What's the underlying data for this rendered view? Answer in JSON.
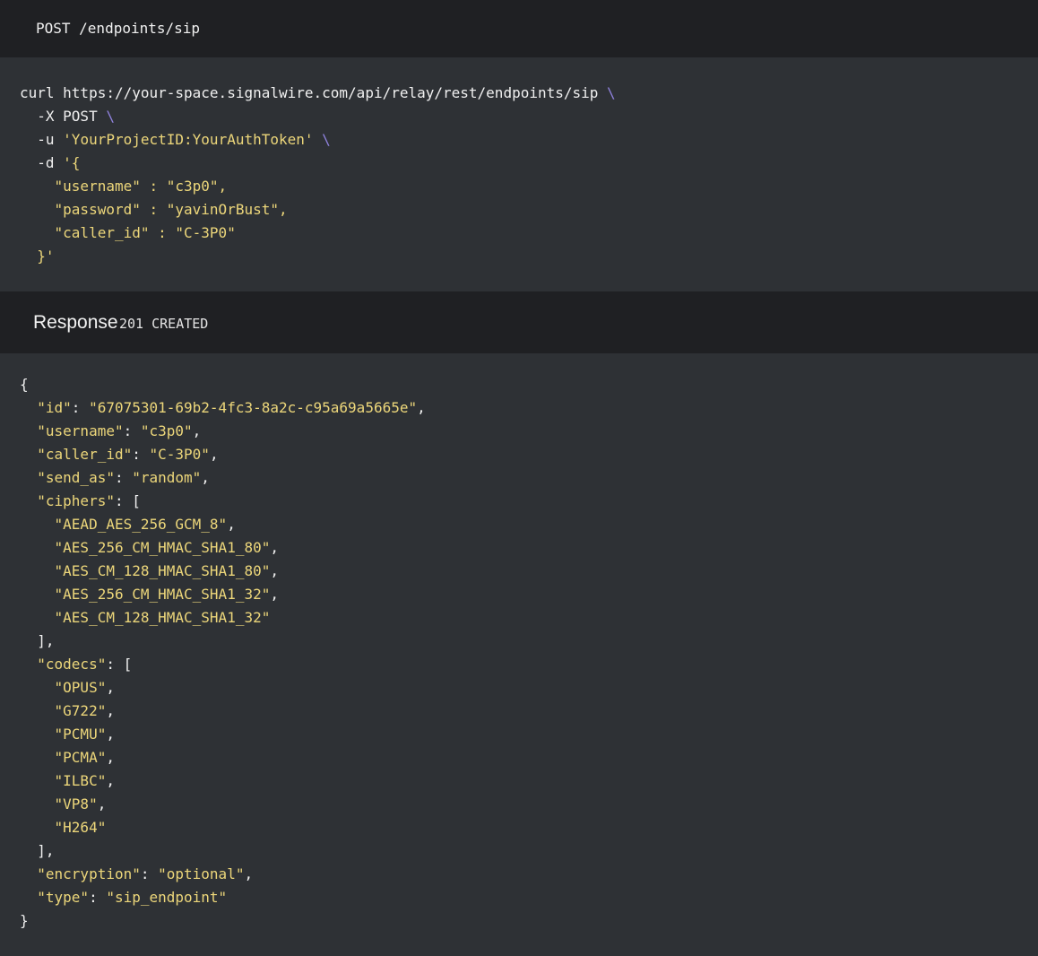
{
  "request": {
    "method_path": "POST /endpoints/sip",
    "lines": [
      [
        {
          "t": "plain",
          "v": "curl https://your-space.signalwire.com/api/relay/rest/endpoints/sip "
        },
        {
          "t": "cont",
          "v": "\\"
        }
      ],
      [
        {
          "t": "plain",
          "v": "  -X POST "
        },
        {
          "t": "cont",
          "v": "\\"
        }
      ],
      [
        {
          "t": "plain",
          "v": "  -u "
        },
        {
          "t": "str",
          "v": "'YourProjectID:YourAuthToken'"
        },
        {
          "t": "plain",
          "v": " "
        },
        {
          "t": "cont",
          "v": "\\"
        }
      ],
      [
        {
          "t": "plain",
          "v": "  -d "
        },
        {
          "t": "str",
          "v": "'{"
        }
      ],
      [
        {
          "t": "str",
          "v": "    \"username\" : \"c3p0\","
        }
      ],
      [
        {
          "t": "str",
          "v": "    \"password\" : \"yavinOrBust\","
        }
      ],
      [
        {
          "t": "str",
          "v": "    \"caller_id\" : \"C-3P0\""
        }
      ],
      [
        {
          "t": "str",
          "v": "  }'"
        }
      ]
    ]
  },
  "response": {
    "title": "Response",
    "status": "201 CREATED",
    "lines": [
      [
        {
          "t": "plain",
          "v": "{"
        }
      ],
      [
        {
          "t": "plain",
          "v": "  "
        },
        {
          "t": "str",
          "v": "\"id\""
        },
        {
          "t": "plain",
          "v": ": "
        },
        {
          "t": "str",
          "v": "\"67075301-69b2-4fc3-8a2c-c95a69a5665e\""
        },
        {
          "t": "plain",
          "v": ","
        }
      ],
      [
        {
          "t": "plain",
          "v": "  "
        },
        {
          "t": "str",
          "v": "\"username\""
        },
        {
          "t": "plain",
          "v": ": "
        },
        {
          "t": "str",
          "v": "\"c3p0\""
        },
        {
          "t": "plain",
          "v": ","
        }
      ],
      [
        {
          "t": "plain",
          "v": "  "
        },
        {
          "t": "str",
          "v": "\"caller_id\""
        },
        {
          "t": "plain",
          "v": ": "
        },
        {
          "t": "str",
          "v": "\"C-3P0\""
        },
        {
          "t": "plain",
          "v": ","
        }
      ],
      [
        {
          "t": "plain",
          "v": "  "
        },
        {
          "t": "str",
          "v": "\"send_as\""
        },
        {
          "t": "plain",
          "v": ": "
        },
        {
          "t": "str",
          "v": "\"random\""
        },
        {
          "t": "plain",
          "v": ","
        }
      ],
      [
        {
          "t": "plain",
          "v": "  "
        },
        {
          "t": "str",
          "v": "\"ciphers\""
        },
        {
          "t": "plain",
          "v": ": ["
        }
      ],
      [
        {
          "t": "plain",
          "v": "    "
        },
        {
          "t": "str",
          "v": "\"AEAD_AES_256_GCM_8\""
        },
        {
          "t": "plain",
          "v": ","
        }
      ],
      [
        {
          "t": "plain",
          "v": "    "
        },
        {
          "t": "str",
          "v": "\"AES_256_CM_HMAC_SHA1_80\""
        },
        {
          "t": "plain",
          "v": ","
        }
      ],
      [
        {
          "t": "plain",
          "v": "    "
        },
        {
          "t": "str",
          "v": "\"AES_CM_128_HMAC_SHA1_80\""
        },
        {
          "t": "plain",
          "v": ","
        }
      ],
      [
        {
          "t": "plain",
          "v": "    "
        },
        {
          "t": "str",
          "v": "\"AES_256_CM_HMAC_SHA1_32\""
        },
        {
          "t": "plain",
          "v": ","
        }
      ],
      [
        {
          "t": "plain",
          "v": "    "
        },
        {
          "t": "str",
          "v": "\"AES_CM_128_HMAC_SHA1_32\""
        }
      ],
      [
        {
          "t": "plain",
          "v": "  ],"
        }
      ],
      [
        {
          "t": "plain",
          "v": "  "
        },
        {
          "t": "str",
          "v": "\"codecs\""
        },
        {
          "t": "plain",
          "v": ": ["
        }
      ],
      [
        {
          "t": "plain",
          "v": "    "
        },
        {
          "t": "str",
          "v": "\"OPUS\""
        },
        {
          "t": "plain",
          "v": ","
        }
      ],
      [
        {
          "t": "plain",
          "v": "    "
        },
        {
          "t": "str",
          "v": "\"G722\""
        },
        {
          "t": "plain",
          "v": ","
        }
      ],
      [
        {
          "t": "plain",
          "v": "    "
        },
        {
          "t": "str",
          "v": "\"PCMU\""
        },
        {
          "t": "plain",
          "v": ","
        }
      ],
      [
        {
          "t": "plain",
          "v": "    "
        },
        {
          "t": "str",
          "v": "\"PCMA\""
        },
        {
          "t": "plain",
          "v": ","
        }
      ],
      [
        {
          "t": "plain",
          "v": "    "
        },
        {
          "t": "str",
          "v": "\"ILBC\""
        },
        {
          "t": "plain",
          "v": ","
        }
      ],
      [
        {
          "t": "plain",
          "v": "    "
        },
        {
          "t": "str",
          "v": "\"VP8\""
        },
        {
          "t": "plain",
          "v": ","
        }
      ],
      [
        {
          "t": "plain",
          "v": "    "
        },
        {
          "t": "str",
          "v": "\"H264\""
        }
      ],
      [
        {
          "t": "plain",
          "v": "  ],"
        }
      ],
      [
        {
          "t": "plain",
          "v": "  "
        },
        {
          "t": "str",
          "v": "\"encryption\""
        },
        {
          "t": "plain",
          "v": ": "
        },
        {
          "t": "str",
          "v": "\"optional\""
        },
        {
          "t": "plain",
          "v": ","
        }
      ],
      [
        {
          "t": "plain",
          "v": "  "
        },
        {
          "t": "str",
          "v": "\"type\""
        },
        {
          "t": "plain",
          "v": ": "
        },
        {
          "t": "str",
          "v": "\"sip_endpoint\""
        }
      ],
      [
        {
          "t": "plain",
          "v": "}"
        }
      ]
    ]
  },
  "colors": {
    "header_bg": "#1f2023",
    "code_bg": "#2e3135",
    "string": "#ecd67a",
    "line_continuation": "#8f82dd",
    "text": "#f0f0f0"
  }
}
